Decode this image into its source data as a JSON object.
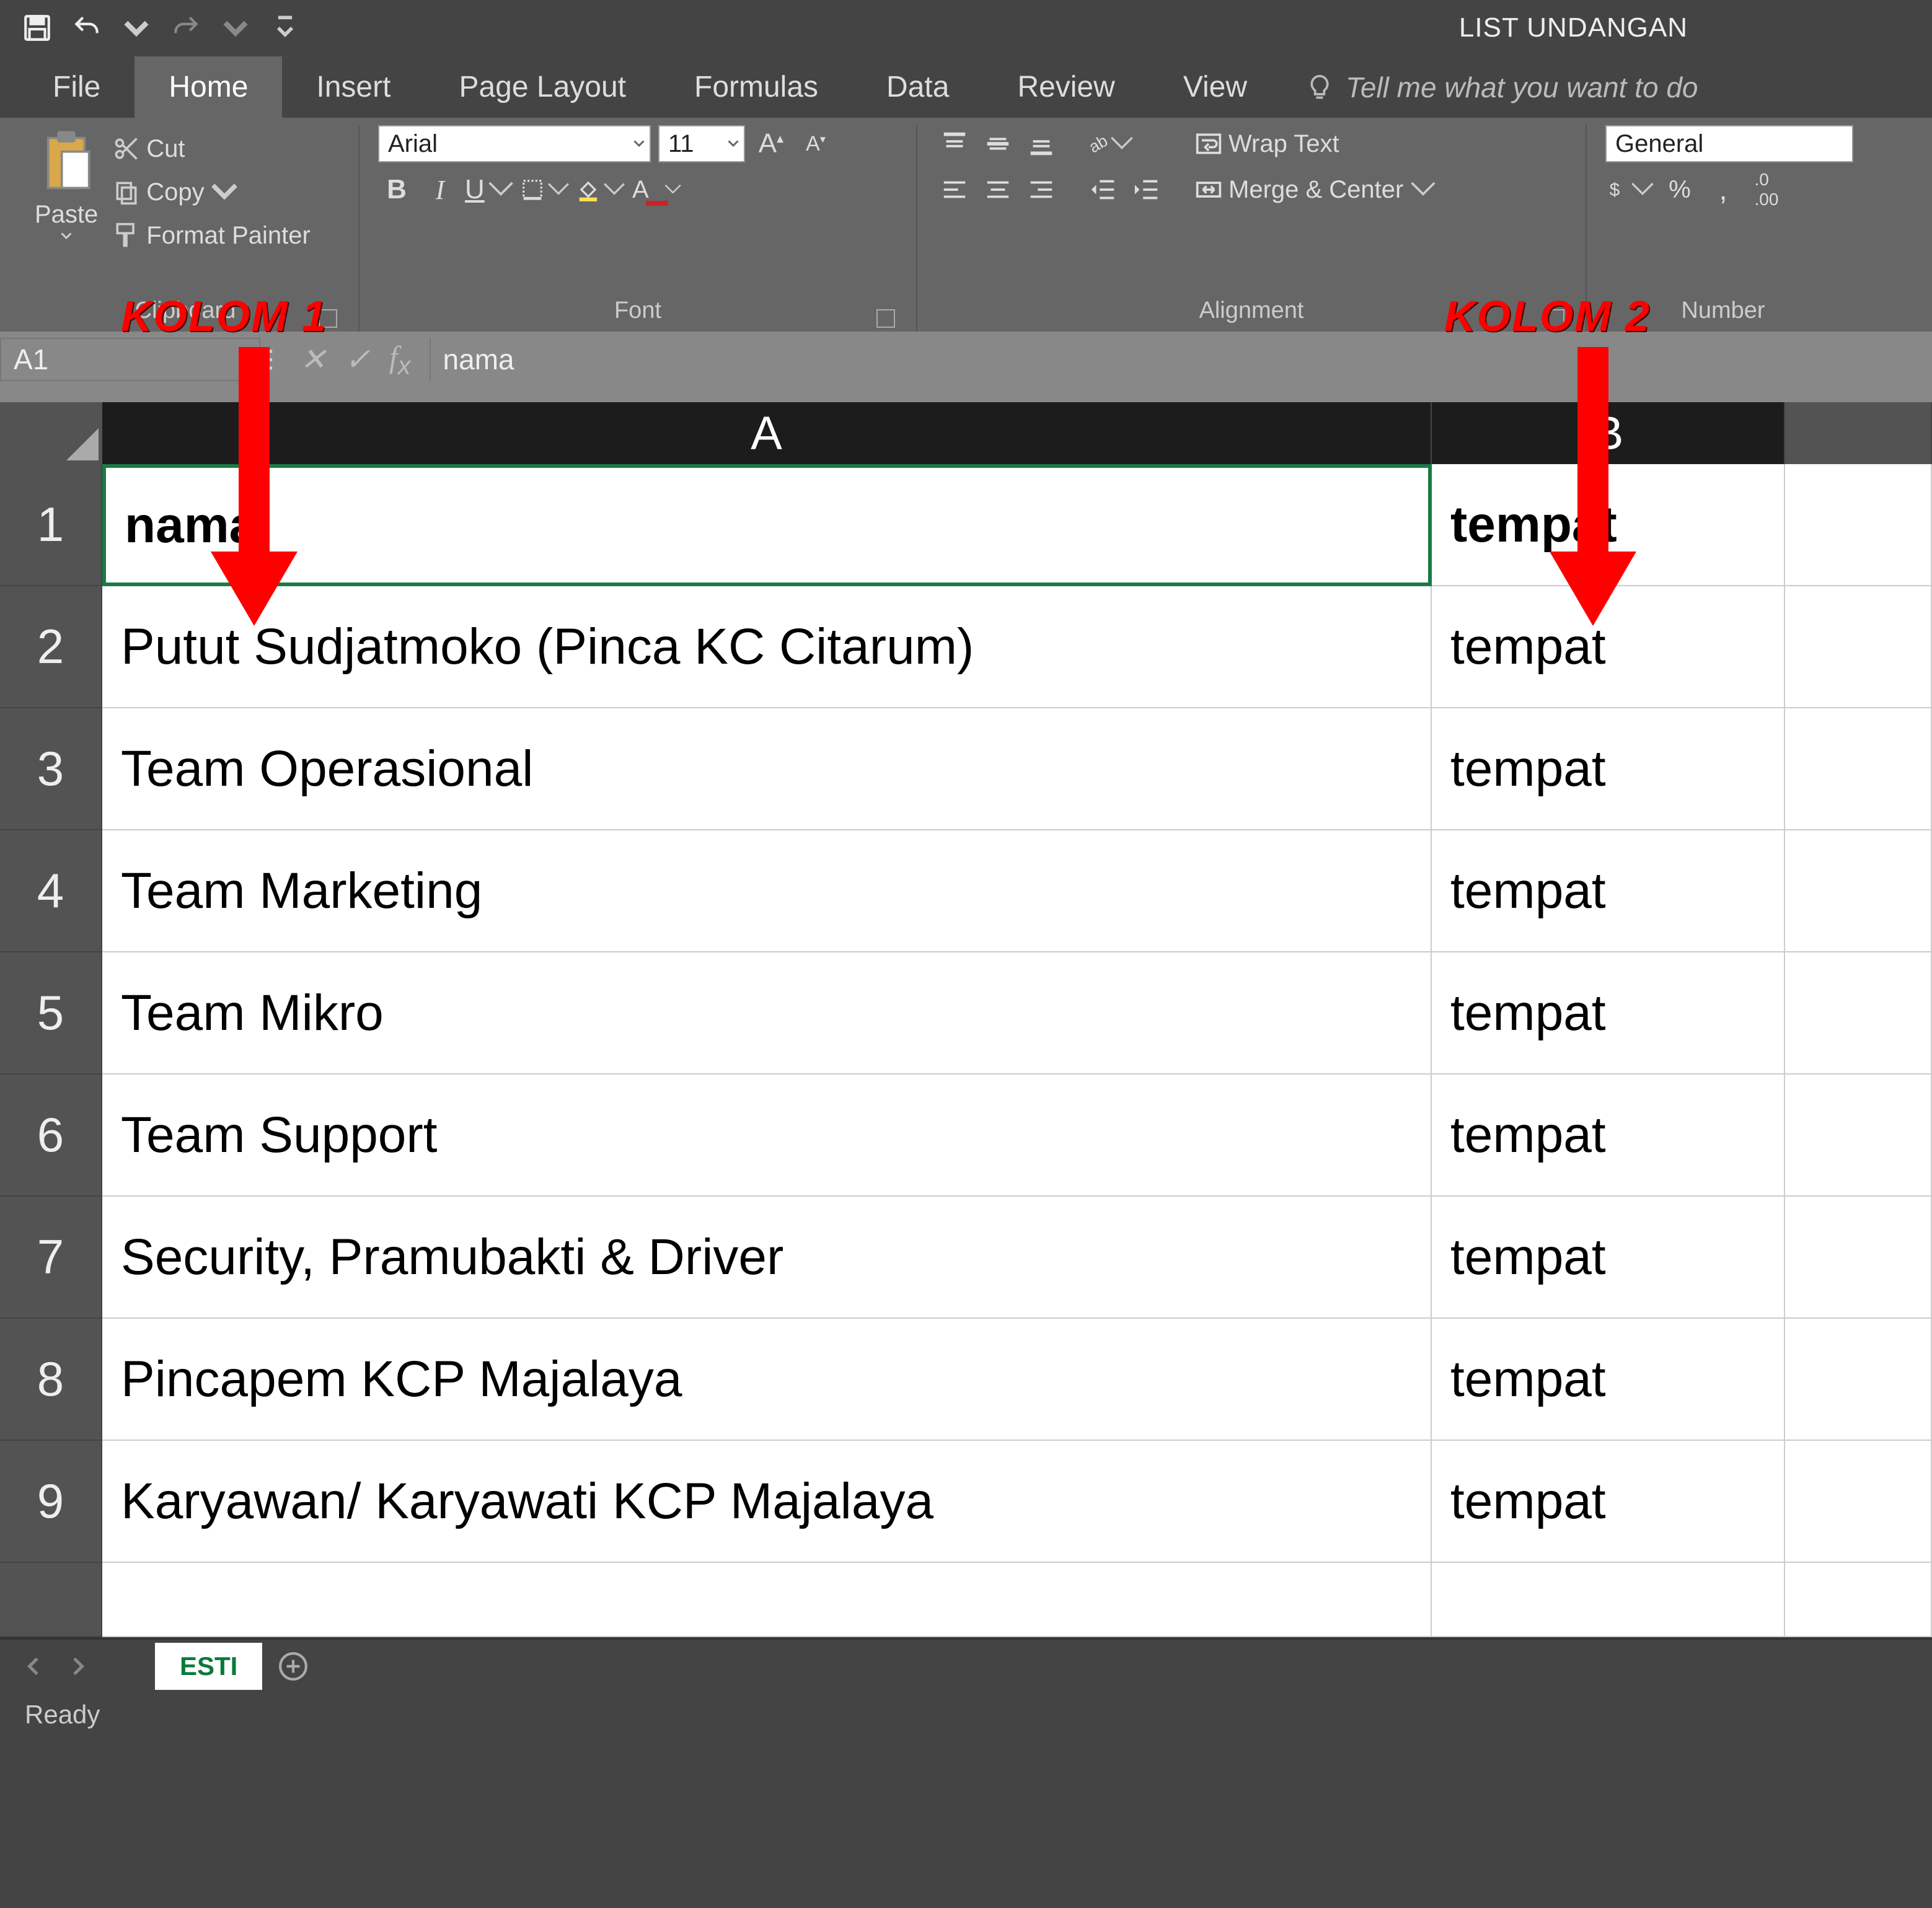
{
  "title": "LIST UNDANGAN",
  "tabs": [
    "File",
    "Home",
    "Insert",
    "Page Layout",
    "Formulas",
    "Data",
    "Review",
    "View"
  ],
  "activeTab": "Home",
  "tellme": "Tell me what you want to do",
  "ribbon": {
    "clipboard": {
      "paste": "Paste",
      "cut": "Cut",
      "copy": "Copy",
      "fp": "Format Painter",
      "label": "Clipboard"
    },
    "font": {
      "name": "Arial",
      "size": "11",
      "label": "Font"
    },
    "alignment": {
      "wrap": "Wrap Text",
      "merge": "Merge & Center",
      "label": "Alignment"
    },
    "number": {
      "format": "General",
      "label": "Number"
    }
  },
  "namebox": "A1",
  "formula": "nama",
  "columns": [
    "A",
    "B"
  ],
  "rows": [
    {
      "n": "1",
      "a": "nama",
      "b": "tempat"
    },
    {
      "n": "2",
      "a": "Putut Sudjatmoko (Pinca KC Citarum)",
      "b": "tempat"
    },
    {
      "n": "3",
      "a": "Team Operasional",
      "b": "tempat"
    },
    {
      "n": "4",
      "a": "Team Marketing",
      "b": "tempat"
    },
    {
      "n": "5",
      "a": "Team Mikro",
      "b": "tempat"
    },
    {
      "n": "6",
      "a": "Team Support",
      "b": "tempat"
    },
    {
      "n": "7",
      "a": "Security, Pramubakti & Driver",
      "b": "tempat"
    },
    {
      "n": "8",
      "a": "Pincapem KCP Majalaya",
      "b": "tempat"
    },
    {
      "n": "9",
      "a": "Karyawan/ Karyawati KCP Majalaya",
      "b": "tempat"
    }
  ],
  "sheet": "ESTI",
  "status": "Ready",
  "annotations": {
    "k1": "KOLOM 1",
    "k2": "KOLOM 2"
  }
}
